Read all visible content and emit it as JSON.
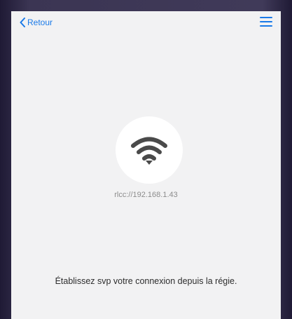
{
  "header": {
    "back_label": "Retour",
    "back_icon": "chevron-left-icon",
    "menu_icon": "hamburger-menu-icon"
  },
  "connection": {
    "status_icon": "wifi-icon",
    "address": "rlcc://192.168.1.43"
  },
  "message": {
    "instruction": "Établissez svp votre connexion depuis la régie."
  },
  "colors": {
    "accent": "#1a7ae8",
    "background": "#f2f2f3",
    "icon": "#4a4a4a",
    "circle": "#ffffff"
  }
}
